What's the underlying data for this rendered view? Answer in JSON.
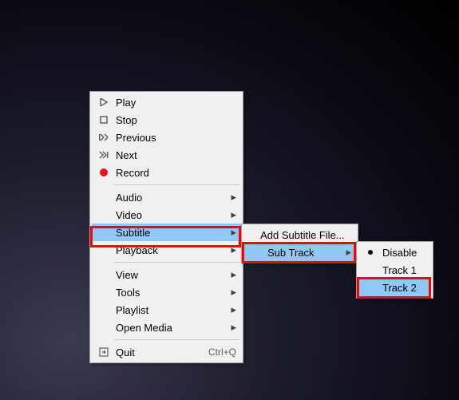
{
  "main_menu": {
    "play": "Play",
    "stop": "Stop",
    "previous": "Previous",
    "next": "Next",
    "record": "Record",
    "audio": "Audio",
    "video": "Video",
    "subtitle": "Subtitle",
    "playback": "Playback",
    "view": "View",
    "tools": "Tools",
    "playlist": "Playlist",
    "open_media": "Open Media",
    "quit": "Quit",
    "quit_shortcut": "Ctrl+Q"
  },
  "subtitle_menu": {
    "add_file": "Add Subtitle File...",
    "sub_track": "Sub Track"
  },
  "track_menu": {
    "disable": "Disable",
    "track1": "Track 1",
    "track2": "Track 2"
  },
  "colors": {
    "highlight": "#90c8f6",
    "annotation": "#ff0000",
    "record": "#e81123"
  }
}
